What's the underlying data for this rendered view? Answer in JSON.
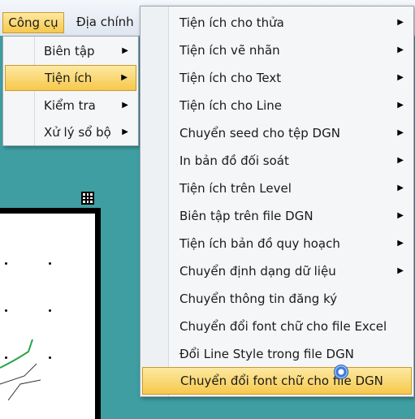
{
  "menubar": {
    "items": [
      {
        "label": "Công cụ"
      },
      {
        "label": "Địa chính"
      }
    ]
  },
  "submenu": {
    "items": [
      {
        "label": "Biên tập",
        "has_arrow": true
      },
      {
        "label": "Tiện ích",
        "has_arrow": true,
        "active": true
      },
      {
        "label": "Kiểm tra",
        "has_arrow": true
      },
      {
        "label": "Xử lý sổ bộ",
        "has_arrow": true
      }
    ]
  },
  "dropdown": {
    "items": [
      {
        "label": "Tiện ích cho thửa",
        "has_arrow": true
      },
      {
        "label": "Tiện ích vẽ nhãn",
        "has_arrow": true
      },
      {
        "label": "Tiện ích cho Text",
        "has_arrow": true
      },
      {
        "label": "Tiện ích cho Line",
        "has_arrow": true
      },
      {
        "label": "Chuyển seed cho tệp DGN",
        "has_arrow": true
      },
      {
        "label": "In bản đồ đối soát",
        "has_arrow": true
      },
      {
        "label": "Tiện ích trên Level",
        "has_arrow": true
      },
      {
        "label": "Biên tập trên file DGN",
        "has_arrow": true
      },
      {
        "label": "Tiện ích bản đồ quy hoạch",
        "has_arrow": true
      },
      {
        "label": "Chuyển định dạng dữ liệu",
        "has_arrow": true
      },
      {
        "label": "Chuyển thông tin đăng ký",
        "has_arrow": false
      },
      {
        "label": "Chuyển đổi font chữ cho file Excel",
        "has_arrow": false
      },
      {
        "label": "Đổi Line Style trong file DGN",
        "has_arrow": false
      },
      {
        "label": "Chuyển đổi font chữ cho file DGN",
        "has_arrow": false,
        "active": true
      }
    ]
  },
  "icons": {
    "submenu_arrow": "arrow-right-icon",
    "canvas_marker": "grid-marker-icon",
    "cursor": "mouse-cursor-icon"
  },
  "colors": {
    "highlight": "#f7c84b",
    "canvas_background": "#3f9ea1"
  }
}
